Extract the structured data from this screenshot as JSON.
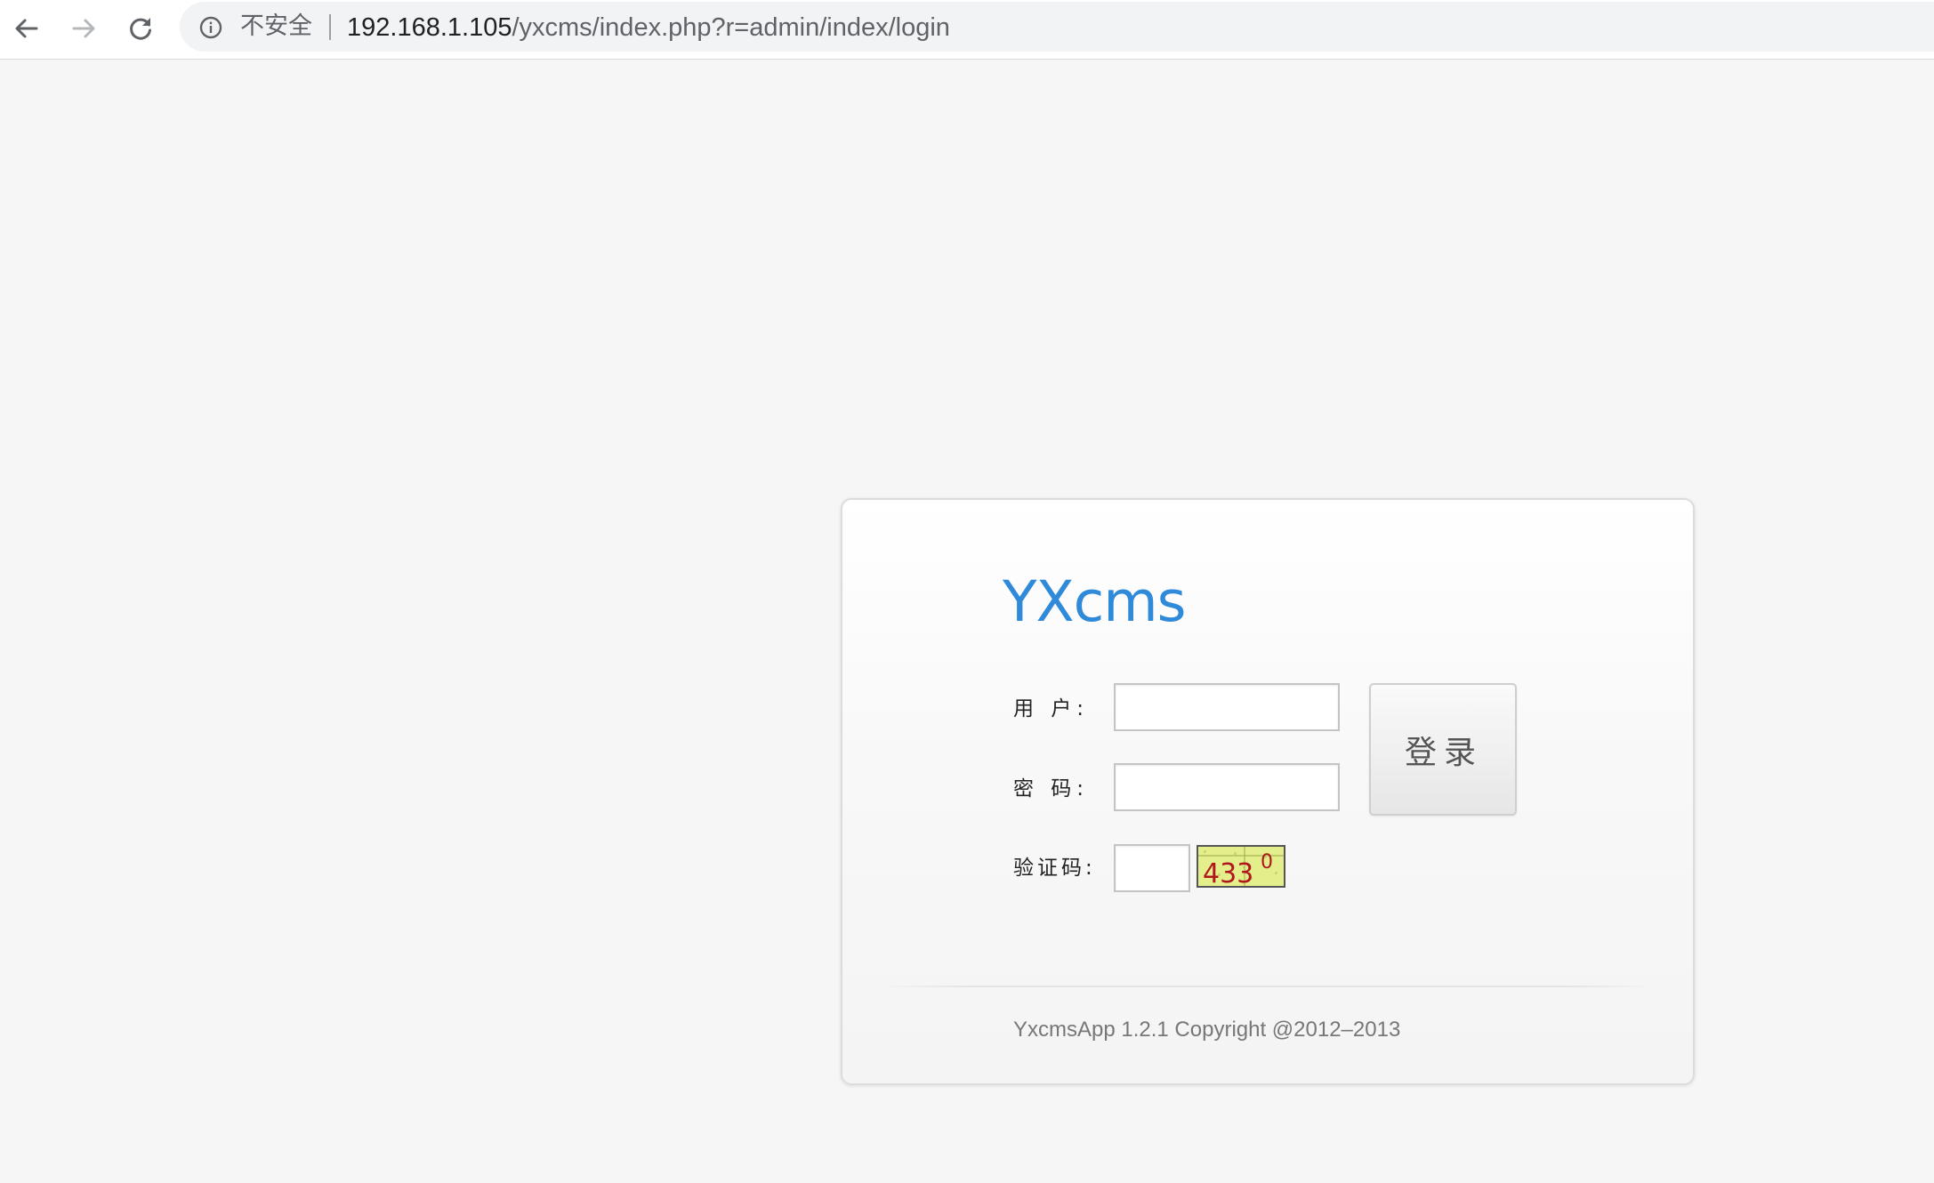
{
  "browser": {
    "security_label": "不安全",
    "url_host": "192.168.1.105",
    "url_path": "/yxcms/index.php?r=admin/index/login",
    "icons": {
      "back": "arrow-left-icon",
      "forward": "arrow-right-icon",
      "reload": "reload-icon",
      "info": "info-icon"
    }
  },
  "login": {
    "logo_text": "YXcms",
    "fields": {
      "username": {
        "label": "用 户:",
        "value": "",
        "placeholder": ""
      },
      "password": {
        "label": "密 码:",
        "value": "",
        "placeholder": ""
      },
      "captcha": {
        "label": "验证码:",
        "value": "",
        "placeholder": "",
        "image_text": "4330"
      }
    },
    "submit_label": "登录",
    "footer": "YxcmsApp 1.2.1 Copyright @2012–2013"
  },
  "colors": {
    "page_background": "#f6f6f6",
    "logo": "#2f8ad9",
    "captcha_background": "#e4ef8c",
    "captcha_digits": "#b0161c",
    "button_text": "#555555",
    "footer_text": "#777777"
  }
}
